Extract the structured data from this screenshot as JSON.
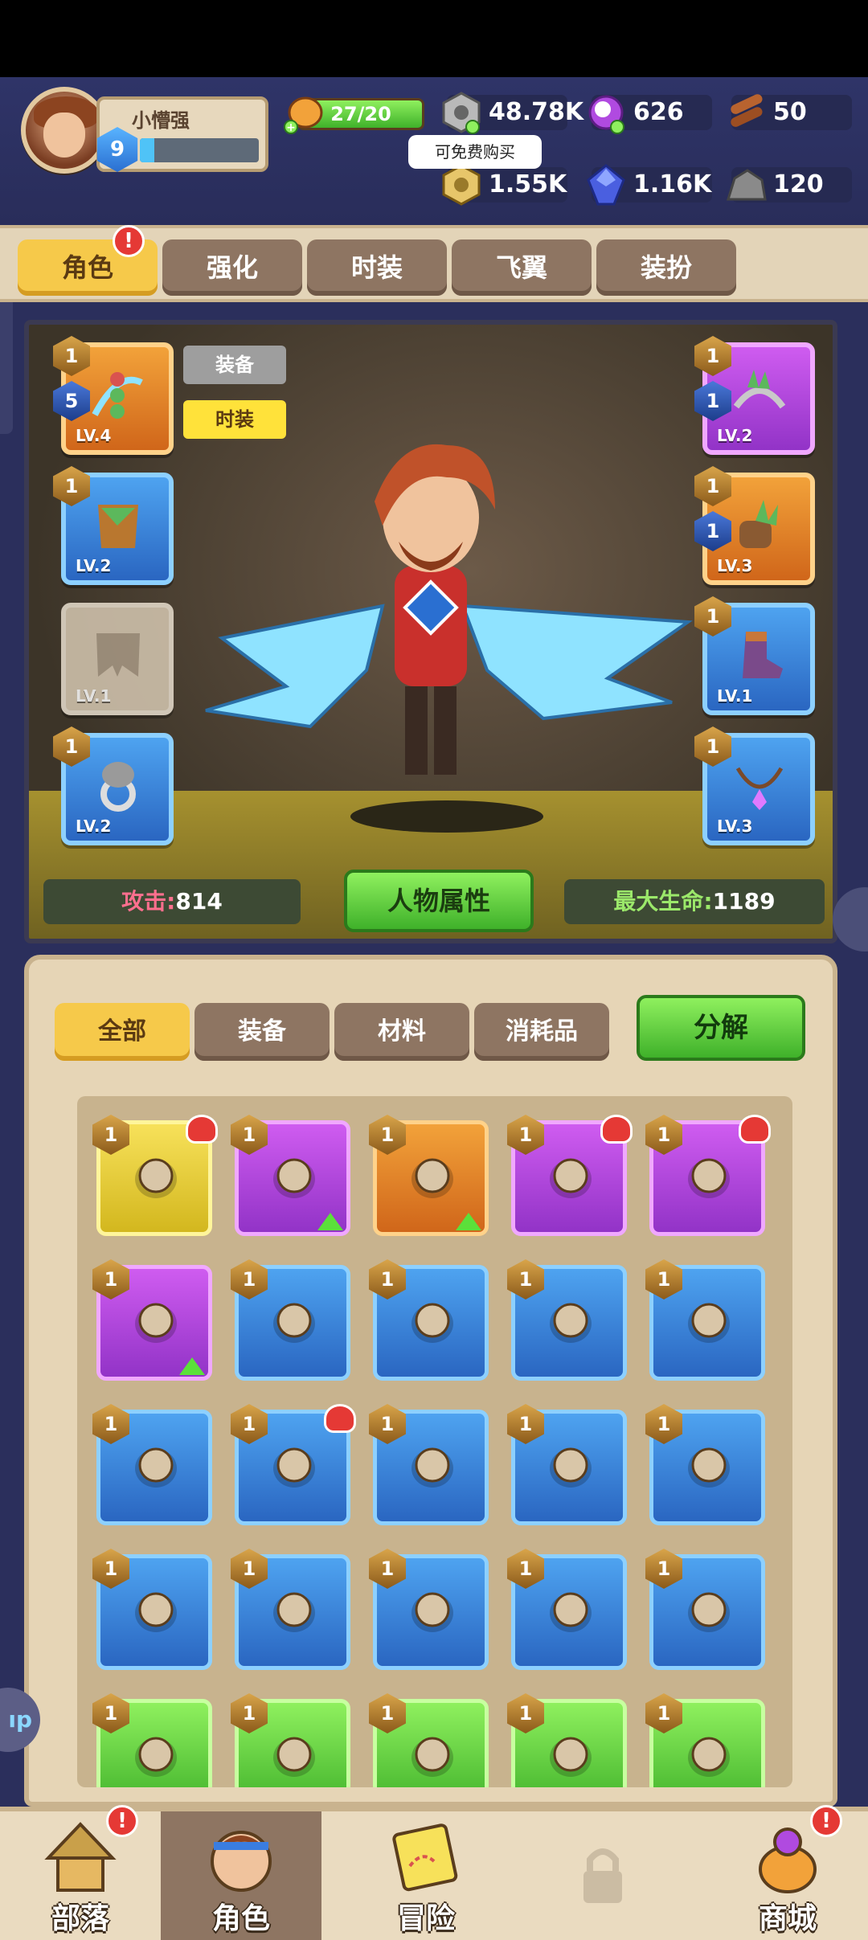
{
  "player": {
    "name": "小懵强",
    "level": "9",
    "xp_fraction": 0.12
  },
  "resources": {
    "stamina": "27/20",
    "stamina_fraction": 1.0,
    "silver": "48.78K",
    "orb": "626",
    "wood": "50",
    "gold": "1.55K",
    "gem": "1.16K",
    "stone": "120"
  },
  "tooltip": "可免费购买",
  "tabs": [
    {
      "label": "角色",
      "active": true,
      "badge": "!"
    },
    {
      "label": "强化"
    },
    {
      "label": "时装"
    },
    {
      "label": "飞翼"
    },
    {
      "label": "装扮"
    }
  ],
  "character": {
    "equip_button": "装备",
    "costume_button": "时装",
    "attack_label": "攻击:",
    "attack_value": "814",
    "hp_label": "最大生命:",
    "hp_value": "1189",
    "attributes_button": "人物属性",
    "slots": {
      "weapon": {
        "num": "1",
        "sub": "5",
        "lv": "LV.4"
      },
      "armor": {
        "num": "1",
        "lv": "LV.2"
      },
      "pants": {
        "lv": "LV.1"
      },
      "ring": {
        "num": "1",
        "lv": "LV.2"
      },
      "helmet": {
        "num": "1",
        "sub": "1",
        "lv": "LV.2"
      },
      "gloves": {
        "num": "1",
        "sub": "1",
        "lv": "LV.3"
      },
      "boots": {
        "num": "1",
        "lv": "LV.1"
      },
      "necklace": {
        "num": "1",
        "lv": "LV.3"
      }
    }
  },
  "inventory": {
    "filters": [
      "全部",
      "装备",
      "材料",
      "消耗品"
    ],
    "decompose": "分解",
    "items": [
      {
        "num": "1",
        "color": "yellow",
        "icon": "shorts-icon",
        "heart": true
      },
      {
        "num": "1",
        "color": "purple",
        "icon": "skull-helmet-icon",
        "up": true
      },
      {
        "num": "1",
        "color": "orange",
        "icon": "horned-cape-icon",
        "up": true
      },
      {
        "num": "1",
        "color": "purple",
        "icon": "leaf-belt-icon",
        "heart": true
      },
      {
        "num": "1",
        "color": "purple",
        "icon": "fur-belt-icon",
        "heart": true
      },
      {
        "num": "1",
        "color": "purple",
        "icon": "necklace-icon",
        "up": true
      },
      {
        "num": "1",
        "color": "blue",
        "icon": "vine-bow-icon"
      },
      {
        "num": "1",
        "color": "blue",
        "icon": "antler-crown-icon"
      },
      {
        "num": "1",
        "color": "blue",
        "icon": "leaf-glove-icon"
      },
      {
        "num": "1",
        "color": "blue",
        "icon": "wrap-glove-icon"
      },
      {
        "num": "1",
        "color": "blue",
        "icon": "fur-bracer-icon"
      },
      {
        "num": "1",
        "color": "blue",
        "icon": "leaf-skirt-icon",
        "heart": true
      },
      {
        "num": "1",
        "color": "blue",
        "icon": "leaf-sandal-icon"
      },
      {
        "num": "1",
        "color": "blue",
        "icon": "leaf-sandal-icon"
      },
      {
        "num": "1",
        "color": "blue",
        "icon": "dino-ring-icon"
      },
      {
        "num": "1",
        "color": "blue",
        "icon": "dino-ring-icon"
      },
      {
        "num": "1",
        "color": "blue",
        "icon": "dino-ring-icon"
      },
      {
        "num": "1",
        "color": "blue",
        "icon": "dino-ring-icon"
      },
      {
        "num": "1",
        "color": "blue",
        "icon": "shell-necklace-icon"
      },
      {
        "num": "1",
        "color": "blue",
        "icon": "shell-necklace-icon"
      },
      {
        "num": "1",
        "color": "green",
        "icon": "bow-icon"
      },
      {
        "num": "1",
        "color": "green",
        "icon": "crossbow-icon"
      },
      {
        "num": "1",
        "color": "green",
        "icon": "dagger-icon"
      },
      {
        "num": "1",
        "color": "green",
        "icon": "skull-helmet-icon"
      },
      {
        "num": "1",
        "color": "green",
        "icon": "feather-headdress-icon"
      }
    ]
  },
  "nav": [
    {
      "label": "部落",
      "icon": "tribe-hut-icon",
      "badge": "!"
    },
    {
      "label": "角色",
      "icon": "hero-face-icon",
      "active": true,
      "heart": true
    },
    {
      "label": "冒险",
      "icon": "map-scroll-icon"
    },
    {
      "label": "",
      "icon": "lock-icon"
    },
    {
      "label": "商城",
      "icon": "shop-bag-icon",
      "badge": "!"
    }
  ],
  "side_label": "ıp"
}
